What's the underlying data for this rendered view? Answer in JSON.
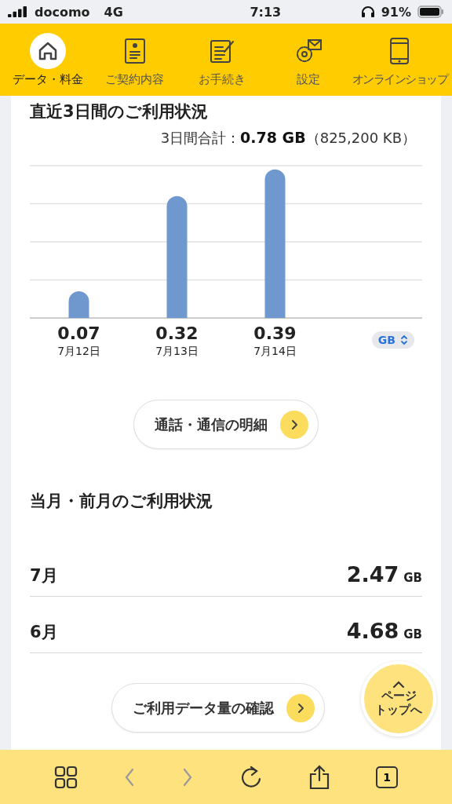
{
  "status_bar": {
    "carrier": "docomo",
    "network": "4G",
    "time": "7:13",
    "battery": "91%"
  },
  "nav": [
    {
      "label": "データ・料金",
      "selected": true
    },
    {
      "label": "ご契約内容",
      "selected": false
    },
    {
      "label": "お手続き",
      "selected": false
    },
    {
      "label": "設定",
      "selected": false
    },
    {
      "label": "オンラインショップ",
      "selected": false
    }
  ],
  "recent": {
    "title": "直近3日間のご利用状況",
    "total": "3日間合計：**0.78 GB**（825,200 KB）",
    "unit": "GB",
    "chart_data": {
      "type": "bar",
      "categories": [
        "7月12日",
        "7月13日",
        "7月14日"
      ],
      "values": [
        0.07,
        0.32,
        0.39
      ],
      "data_labels": true
    },
    "detail_button": "通話・通信の明細"
  },
  "monthly": {
    "title": "当月・前月のご利用状況",
    "rows": [
      {
        "month": "7月",
        "value": "2.47",
        "unit": "GB"
      },
      {
        "month": "6月",
        "value": "4.68",
        "unit": "GB"
      }
    ],
    "check_button": "ご利用データ量の確認"
  },
  "page_top": [
    "ページ",
    "トップへ"
  ],
  "browser_toolbar": {
    "tab_count": "1"
  }
}
